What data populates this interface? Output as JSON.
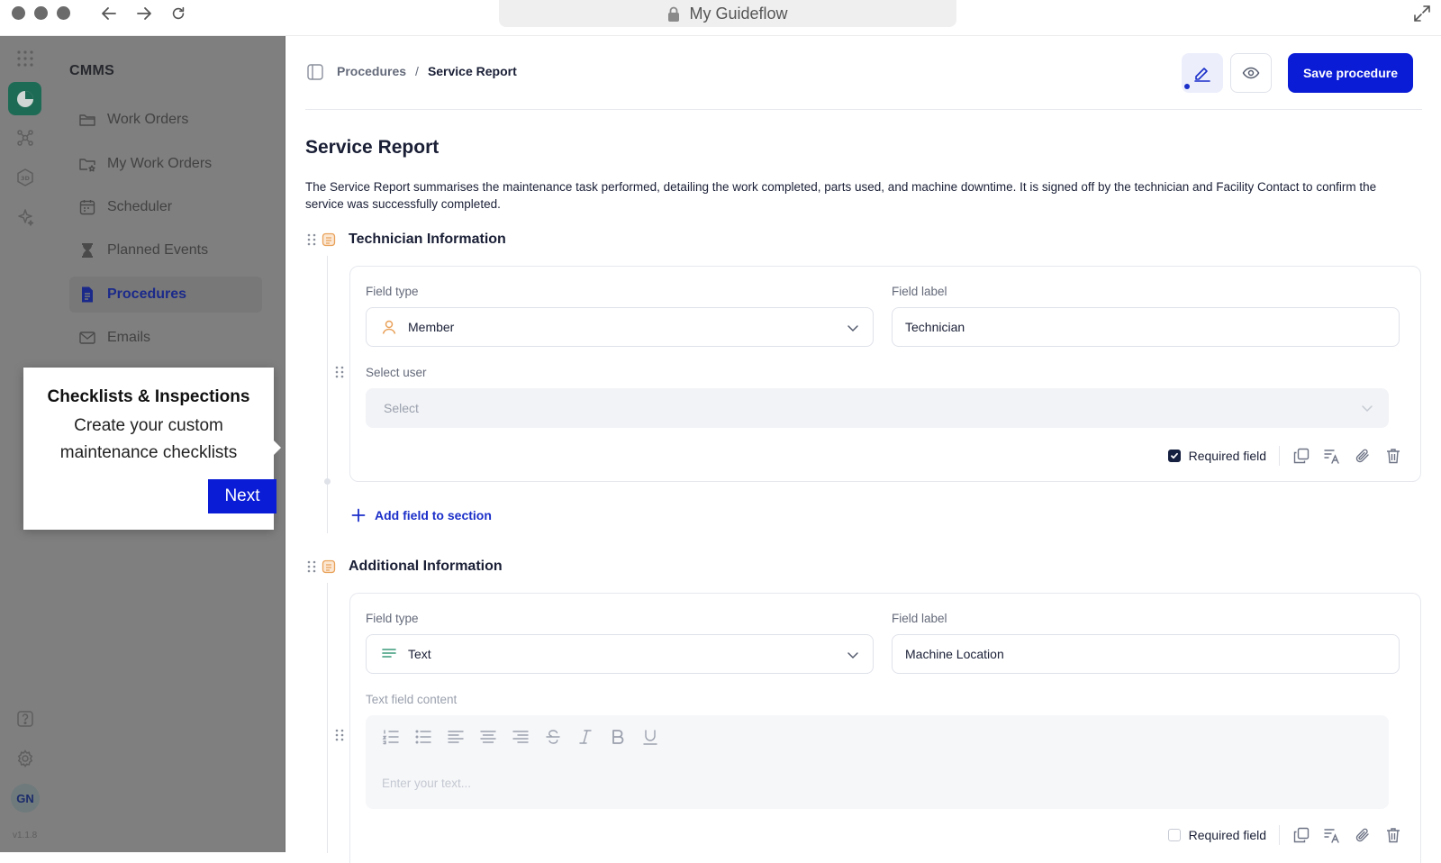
{
  "browser": {
    "url_title": "My Guideflow"
  },
  "sidebar": {
    "title": "CMMS",
    "items": [
      {
        "label": "Work Orders",
        "icon": "folder-icon"
      },
      {
        "label": "My Work Orders",
        "icon": "folder-star-icon"
      },
      {
        "label": "Scheduler",
        "icon": "calendar-icon"
      },
      {
        "label": "Planned Events",
        "icon": "hourglass-icon"
      },
      {
        "label": "Procedures",
        "icon": "document-icon",
        "active": true
      },
      {
        "label": "Emails",
        "icon": "mail-icon"
      }
    ],
    "avatar": "GN",
    "version": "v1.1.8"
  },
  "tooltip": {
    "title": "Checklists & Inspections",
    "body": "Create your custom maintenance checklists",
    "next_label": "Next"
  },
  "header": {
    "breadcrumb_parent": "Procedures",
    "breadcrumb_sep": "/",
    "breadcrumb_current": "Service Report",
    "save_label": "Save procedure"
  },
  "page": {
    "title": "Service Report",
    "description": "The Service Report summarises the maintenance task performed, detailing the work completed, parts used, and machine downtime. It is signed off by the technician and Facility Contact to confirm the service was successfully completed."
  },
  "sections": [
    {
      "title": "Technician Information",
      "field_type_label": "Field type",
      "field_type_value": "Member",
      "field_label_label": "Field label",
      "field_label_value": "Technician",
      "select_user_label": "Select user",
      "select_user_placeholder": "Select",
      "required_label": "Required field",
      "required": true,
      "add_field_label": "Add field to section"
    },
    {
      "title": "Additional Information",
      "field_type_label": "Field type",
      "field_type_value": "Text",
      "field_label_label": "Field label",
      "field_label_value": "Machine Location",
      "content_label": "Text field content",
      "content_placeholder": "Enter your text...",
      "required_label": "Required field",
      "required": false
    }
  ],
  "colors": {
    "primary": "#0a1cd6",
    "overlay": "#7f7f7f",
    "section_icon": "#e9a25b",
    "rail_active": "#1e6b55"
  }
}
